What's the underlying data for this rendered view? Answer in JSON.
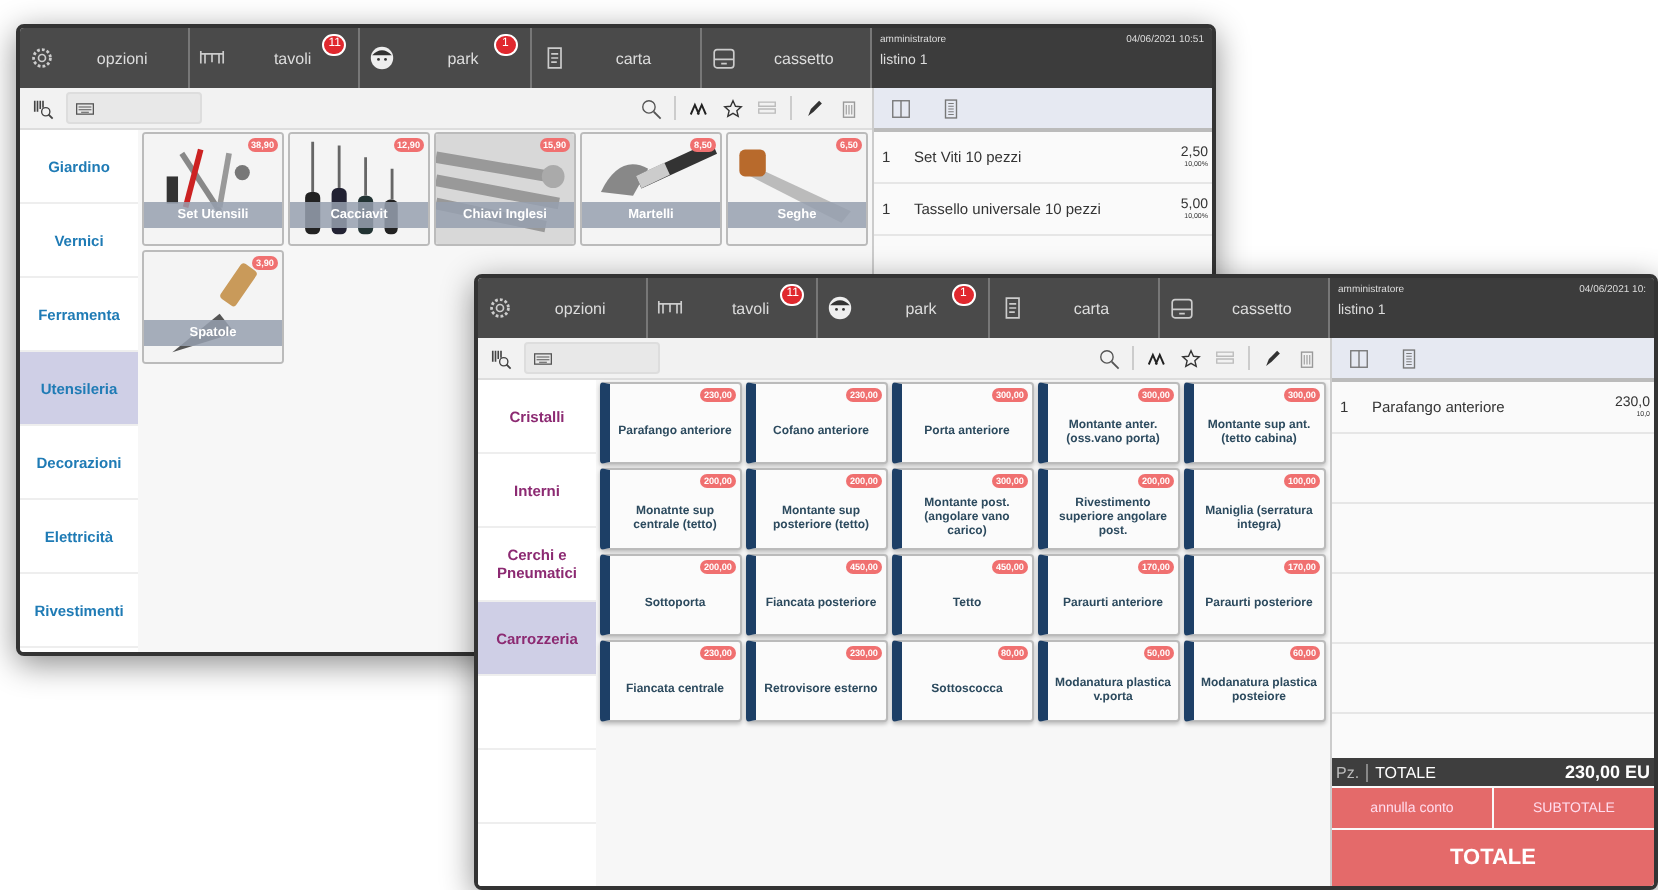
{
  "windows": [
    {
      "top_bar": [
        {
          "label": "opzioni"
        },
        {
          "label": "tavoli",
          "badge": "11"
        },
        {
          "label": "park",
          "badge": "1"
        },
        {
          "label": "carta"
        },
        {
          "label": "cassetto"
        }
      ],
      "order_header": {
        "user": "amministratore",
        "date": "04/06/2021 10:51",
        "price_list": "listino 1"
      },
      "categories": [
        {
          "label": "Giardino",
          "selected": false
        },
        {
          "label": "Vernici",
          "selected": false
        },
        {
          "label": "Ferramenta",
          "selected": false
        },
        {
          "label": "Utensileria",
          "selected": true
        },
        {
          "label": "Decorazioni",
          "selected": false
        },
        {
          "label": "Elettricità",
          "selected": false
        },
        {
          "label": "Rivestimenti",
          "selected": false
        }
      ],
      "products": [
        {
          "name": "Set Utensili",
          "price": "38,90"
        },
        {
          "name": "Cacciavit",
          "price": "12,90"
        },
        {
          "name": "Chiavi Inglesi",
          "price": "15,90"
        },
        {
          "name": "Martelli",
          "price": "8,50"
        },
        {
          "name": "Seghe",
          "price": "6,50"
        },
        {
          "name": "Spatole",
          "price": "3,90"
        }
      ],
      "order_lines": [
        {
          "qty": "1",
          "name": "Set Viti 10 pezzi",
          "price": "2,50",
          "vat": "10,00%"
        },
        {
          "qty": "1",
          "name": "Tassello universale 10 pezzi",
          "price": "5,00",
          "vat": "10,00%"
        }
      ]
    },
    {
      "kind": "plain",
      "top_bar": [
        {
          "label": "opzioni"
        },
        {
          "label": "tavoli",
          "badge": "11"
        },
        {
          "label": "park",
          "badge": "1"
        },
        {
          "label": "carta"
        },
        {
          "label": "cassetto"
        }
      ],
      "order_header": {
        "user": "amministratore",
        "date": "04/06/2021 10:",
        "price_list": "listino 1"
      },
      "categories": [
        {
          "label": "Cristalli",
          "selected": false
        },
        {
          "label": "Interni",
          "selected": false
        },
        {
          "label": "Cerchi e Pneumatici",
          "selected": false
        },
        {
          "label": "Carrozzeria",
          "selected": true
        }
      ],
      "products": [
        {
          "name": "Parafango anteriore",
          "price": "230,00"
        },
        {
          "name": "Cofano anteriore",
          "price": "230,00"
        },
        {
          "name": "Porta anteriore",
          "price": "300,00"
        },
        {
          "name": "Montante anter. (oss.vano porta)",
          "price": "300,00"
        },
        {
          "name": "Montante sup ant. (tetto cabina)",
          "price": "300,00"
        },
        {
          "name": "Monatnte sup centrale (tetto)",
          "price": "200,00"
        },
        {
          "name": "Montante sup posteriore (tetto)",
          "price": "200,00"
        },
        {
          "name": "Montante post. (angolare vano carico)",
          "price": "300,00"
        },
        {
          "name": "Rivestimento superiore angolare post.",
          "price": "200,00"
        },
        {
          "name": "Maniglia (serratura integra)",
          "price": "100,00"
        },
        {
          "name": "Sottoporta",
          "price": "200,00"
        },
        {
          "name": "Fiancata posteriore",
          "price": "450,00"
        },
        {
          "name": "Tetto",
          "price": "450,00"
        },
        {
          "name": "Paraurti anteriore",
          "price": "170,00"
        },
        {
          "name": "Paraurti posteriore",
          "price": "170,00"
        },
        {
          "name": "Fiancata centrale",
          "price": "230,00"
        },
        {
          "name": "Retrovisore esterno",
          "price": "230,00"
        },
        {
          "name": "Sottoscocca",
          "price": "80,00"
        },
        {
          "name": "Modanatura plastica v.porta",
          "price": "50,00"
        },
        {
          "name": "Modanatura plastica posteiore",
          "price": "60,00"
        }
      ],
      "order_lines": [
        {
          "qty": "1",
          "name": "Parafango anteriore",
          "price": "230,0",
          "vat": "10,0"
        }
      ],
      "totals": {
        "pieces_label": "Pz.",
        "total_label": "TOTALE",
        "amount": "230,00 EU",
        "cancel": "annulla conto",
        "subtotal": "SUBTOTALE",
        "total_button": "TOTALE"
      }
    }
  ]
}
